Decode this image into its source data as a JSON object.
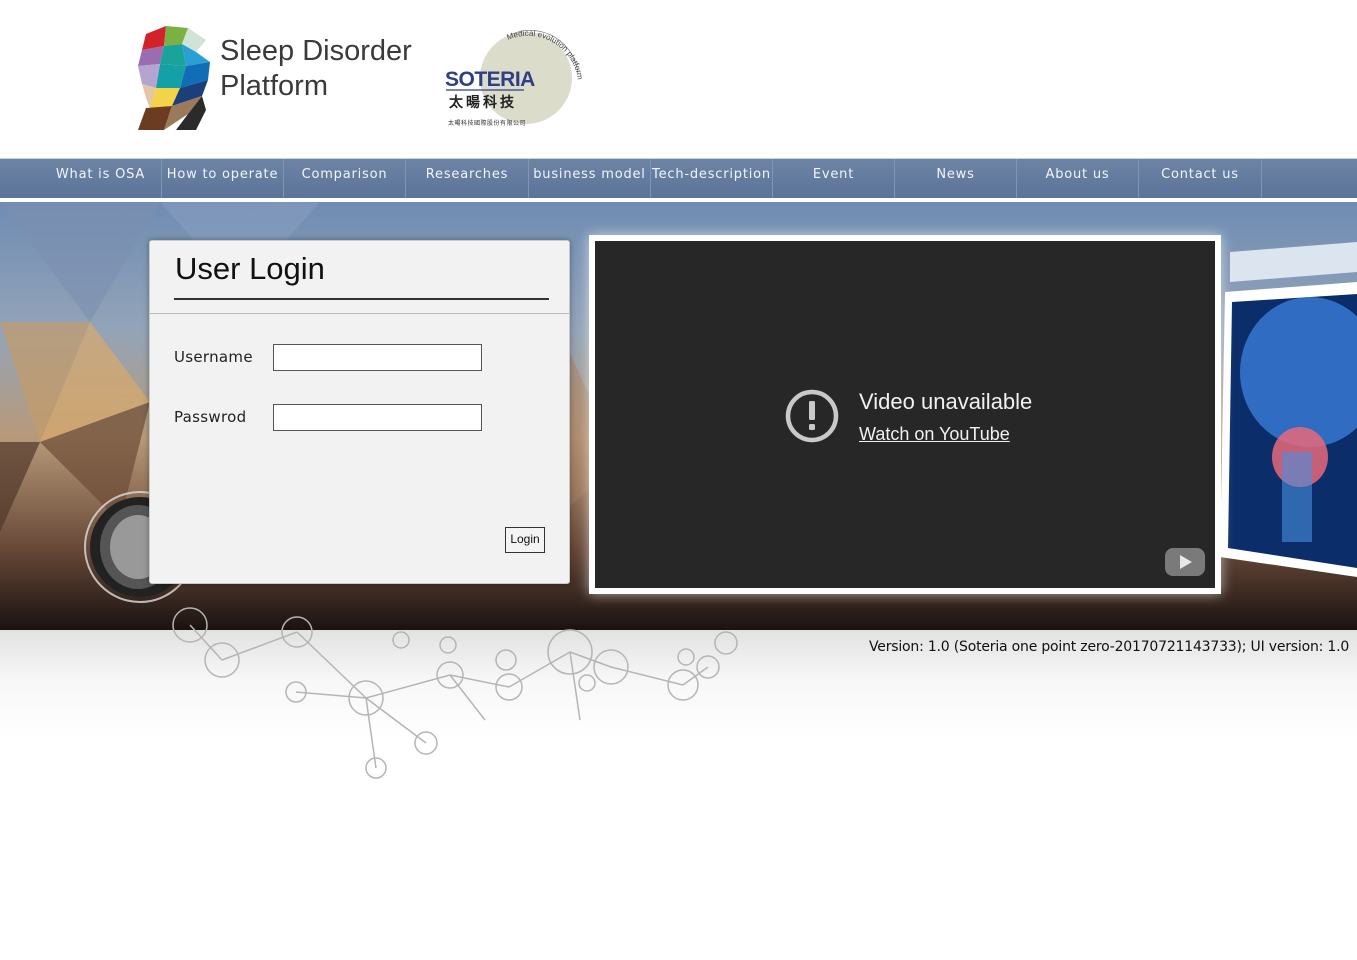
{
  "brand": {
    "title_line1": "Sleep Disorder",
    "title_line2": "Platform",
    "partner_name_en": "SOTERIA",
    "partner_name_zh": "太暘科技",
    "partner_tagline": "Medical evolution platform",
    "partner_company": "太暘科技國際股份有限公司"
  },
  "nav": {
    "items": [
      {
        "label": "What is OSA"
      },
      {
        "label": "How to operate"
      },
      {
        "label": "Comparison"
      },
      {
        "label": "Researches"
      },
      {
        "label": "business model"
      },
      {
        "label": "Tech-description"
      },
      {
        "label": "Event"
      },
      {
        "label": "News"
      },
      {
        "label": "About us"
      },
      {
        "label": "Contact us"
      }
    ]
  },
  "login": {
    "title": "User Login",
    "username_label": "Username",
    "username_value": "",
    "password_label": "Passwrod",
    "password_value": "",
    "button_label": "Login"
  },
  "video": {
    "message": "Video unavailable",
    "link": "Watch on YouTube"
  },
  "footer": {
    "version": "Version: 1.0 (Soteria one point zero-20170721143733); UI version: 1.0"
  },
  "colors": {
    "nav_bg": "#607a9d",
    "partner_blue": "#2f3f86",
    "video_bg": "#272727"
  }
}
